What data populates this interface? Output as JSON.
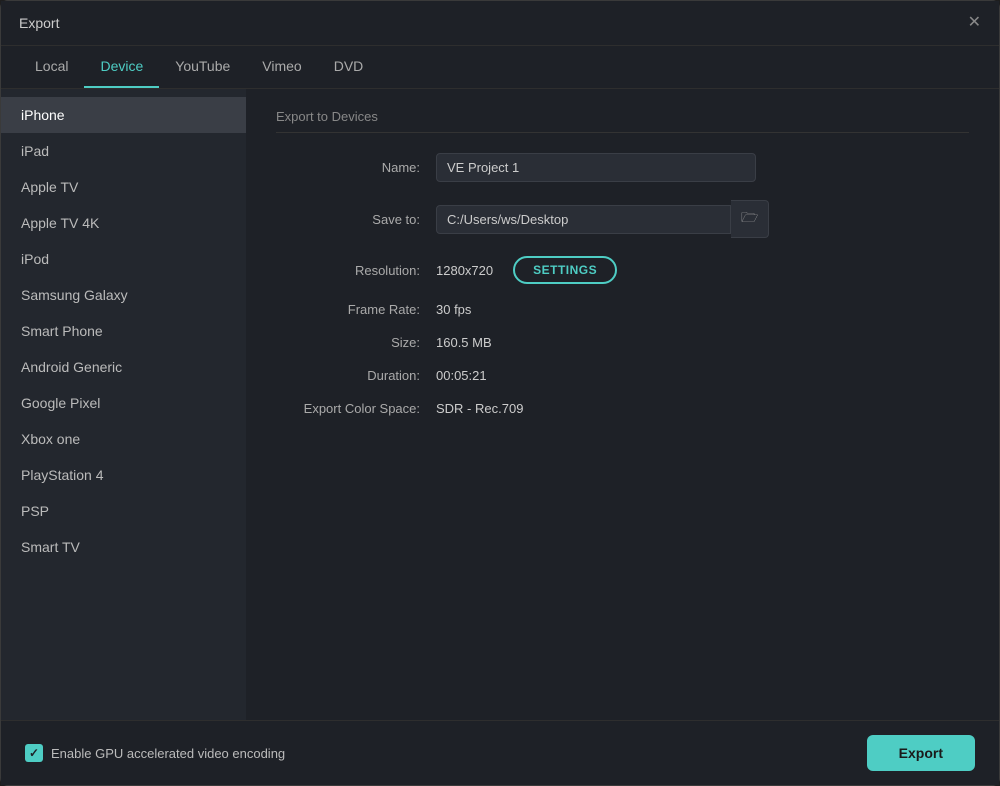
{
  "window": {
    "title": "Export"
  },
  "tabs": [
    {
      "id": "local",
      "label": "Local",
      "active": false
    },
    {
      "id": "device",
      "label": "Device",
      "active": true
    },
    {
      "id": "youtube",
      "label": "YouTube",
      "active": false
    },
    {
      "id": "vimeo",
      "label": "Vimeo",
      "active": false
    },
    {
      "id": "dvd",
      "label": "DVD",
      "active": false
    }
  ],
  "sidebar": {
    "items": [
      {
        "id": "iphone",
        "label": "iPhone",
        "active": true
      },
      {
        "id": "ipad",
        "label": "iPad",
        "active": false
      },
      {
        "id": "apple-tv",
        "label": "Apple TV",
        "active": false
      },
      {
        "id": "apple-tv-4k",
        "label": "Apple TV 4K",
        "active": false
      },
      {
        "id": "ipod",
        "label": "iPod",
        "active": false
      },
      {
        "id": "samsung-galaxy",
        "label": "Samsung Galaxy",
        "active": false
      },
      {
        "id": "smart-phone",
        "label": "Smart Phone",
        "active": false
      },
      {
        "id": "android-generic",
        "label": "Android Generic",
        "active": false
      },
      {
        "id": "google-pixel",
        "label": "Google Pixel",
        "active": false
      },
      {
        "id": "xbox-one",
        "label": "Xbox one",
        "active": false
      },
      {
        "id": "playstation-4",
        "label": "PlayStation 4",
        "active": false
      },
      {
        "id": "psp",
        "label": "PSP",
        "active": false
      },
      {
        "id": "smart-tv",
        "label": "Smart TV",
        "active": false
      }
    ]
  },
  "panel": {
    "section_title": "Export to Devices",
    "fields": {
      "name_label": "Name:",
      "name_value": "VE Project 1",
      "save_to_label": "Save to:",
      "save_to_value": "C:/Users/ws/Desktop",
      "resolution_label": "Resolution:",
      "resolution_value": "1280x720",
      "settings_btn_label": "SETTINGS",
      "frame_rate_label": "Frame Rate:",
      "frame_rate_value": "30 fps",
      "size_label": "Size:",
      "size_value": "160.5 MB",
      "duration_label": "Duration:",
      "duration_value": "00:05:21",
      "color_space_label": "Export Color Space:",
      "color_space_value": "SDR - Rec.709"
    }
  },
  "footer": {
    "gpu_checkbox_label": "Enable GPU accelerated video encoding",
    "export_btn_label": "Export"
  },
  "icons": {
    "close": "✕",
    "folder": "🗁"
  }
}
